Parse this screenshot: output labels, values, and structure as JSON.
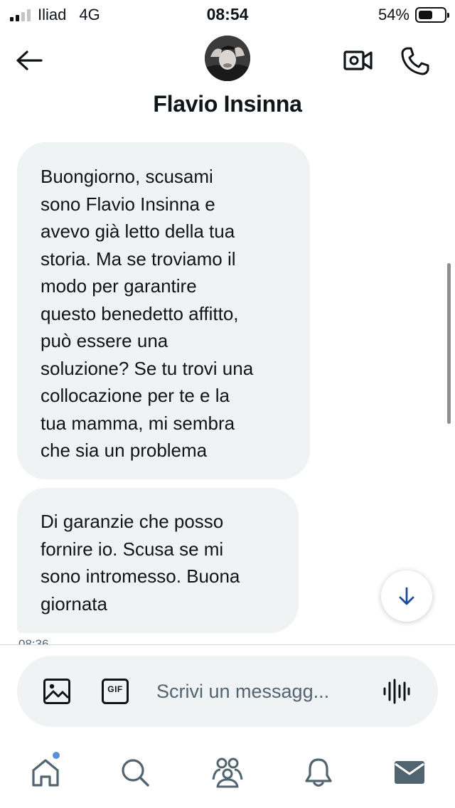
{
  "status_bar": {
    "carrier": "Iliad",
    "network": "4G",
    "time": "08:54",
    "battery_percent_label": "54%",
    "battery_level": 0.54
  },
  "header": {
    "contact_name": "Flavio Insinna",
    "back_icon": "arrow-left-icon",
    "video_icon": "video-camera-icon",
    "call_icon": "phone-icon"
  },
  "messages": [
    {
      "lines": [
        "Buongiorno, scusami",
        "sono Flavio Insinna e",
        "avevo già letto della tua",
        "storia. Ma se troviamo il",
        "modo per garantire",
        "questo benedetto affitto,",
        "può essere una",
        "soluzione? Se tu trovi una",
        "collocazione per te e la",
        "tua mamma, mi sembra",
        "che sia un problema"
      ]
    },
    {
      "lines": [
        "Di garanzie che posso",
        "fornire io. Scusa se mi",
        "sono intromesso. Buona",
        "giornata"
      ]
    }
  ],
  "timestamp": "08:36",
  "composer": {
    "placeholder": "Scrivi un messagg...",
    "value": "",
    "media_icon": "image-icon",
    "gif_label": "GIF",
    "voice_icon": "voice-wave-icon"
  },
  "nav": [
    "home-icon",
    "search-icon",
    "communities-icon",
    "bell-icon",
    "mail-icon"
  ],
  "colors": {
    "bubble_bg": "#eff3f4",
    "text": "#0f1419",
    "muted": "#536471",
    "accent": "#1d4e9e",
    "notification_dot": "#5b8fd6"
  }
}
